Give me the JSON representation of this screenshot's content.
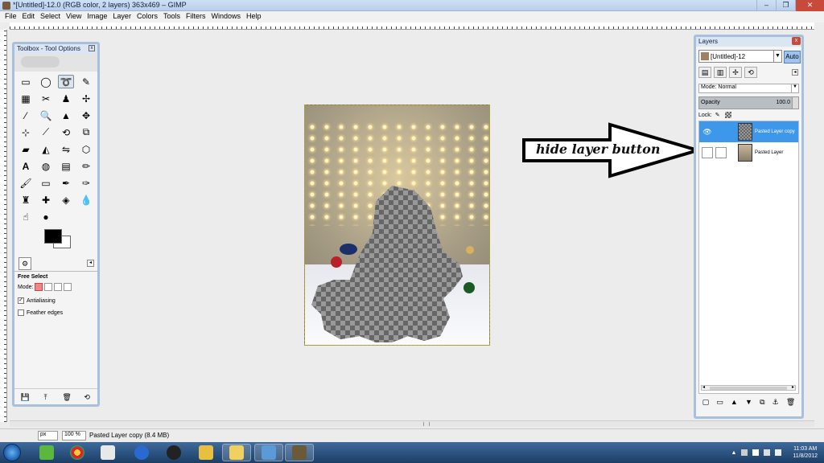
{
  "window": {
    "title": "*[Untitled]-12.0 (RGB color, 2 layers) 363x469 – GIMP",
    "minimize": "–",
    "maximize": "❐",
    "close": "✕"
  },
  "menu": [
    "File",
    "Edit",
    "Select",
    "View",
    "Image",
    "Layer",
    "Colors",
    "Tools",
    "Filters",
    "Windows",
    "Help"
  ],
  "toolbox": {
    "title": "Toolbox - Tool Options",
    "tool_options": {
      "tool_name": "Free Select",
      "mode_label": "Mode:",
      "antialiasing_label": "Antialiasing",
      "antialiasing_checked": true,
      "feather_label": "Feather edges",
      "feather_checked": false
    }
  },
  "annotation": {
    "text": "hide layer button"
  },
  "layers_panel": {
    "title": "Layers",
    "image_name": "[Untitled]-12",
    "auto_label": "Auto",
    "mode_label": "Mode:",
    "mode_value": "Normal",
    "opacity_label": "Opacity",
    "opacity_value": "100.0",
    "lock_label": "Lock:",
    "layers": [
      {
        "name": "Pasted Layer copy",
        "visible": true,
        "selected": true
      },
      {
        "name": "Pasted Layer",
        "visible": false,
        "selected": false
      }
    ]
  },
  "statusbar": {
    "unit": "px",
    "zoom": "100 %",
    "message": "Pasted Layer copy (8.4 MB)"
  },
  "taskbar": {
    "time": "11:03 AM",
    "date": "11/8/2012"
  },
  "colors": {
    "selected_layer": "#3d97eb",
    "title_bar": "#cfe0f4",
    "taskbar": "#1c3e66"
  }
}
